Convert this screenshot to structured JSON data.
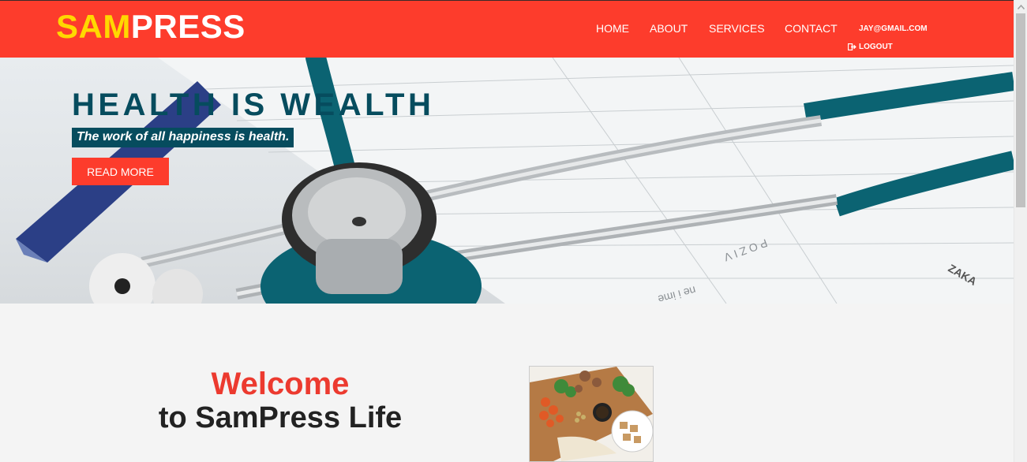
{
  "brand": {
    "part1": "SAM",
    "part2": "PRESS"
  },
  "nav": {
    "home": "HOME",
    "about": "ABOUT",
    "services": "SERVICES",
    "contact": "CONTACT",
    "email": "JAY@GMAIL.COM",
    "logout": "LOGOUT"
  },
  "hero": {
    "title": "HEALTH IS WEALTH",
    "subtitle": "The work of all happiness is health.",
    "button": "READ MORE"
  },
  "welcome": {
    "line1": "Welcome",
    "line2": "to SamPress Life"
  },
  "colors": {
    "brand_red": "#fd3c2c",
    "logo_yellow": "#ffd800",
    "hero_teal": "#064c5e"
  }
}
